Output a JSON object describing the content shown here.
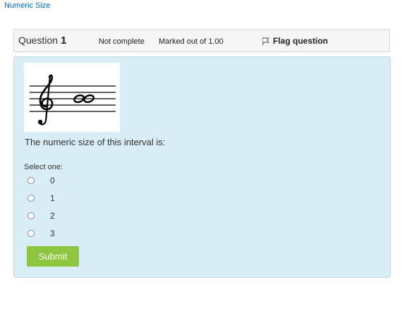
{
  "breadcrumb": {
    "title": "Numeric Size"
  },
  "question_info": {
    "label": "Question",
    "number": "1",
    "state": "Not complete",
    "grade": "Marked out of 1.00",
    "flag_label": "Flag question"
  },
  "question": {
    "text": "The numeric size of this interval is:",
    "prompt": "Select one:",
    "options": [
      "0",
      "1",
      "2",
      "3"
    ],
    "submit_label": "Submit"
  },
  "colors": {
    "link": "#0a66b2",
    "content_bg": "#d9edf6",
    "submit_bg": "#8cc63f"
  },
  "icons": {
    "flag": "flag-icon",
    "staff_image": "treble-clef-unison-notation"
  }
}
